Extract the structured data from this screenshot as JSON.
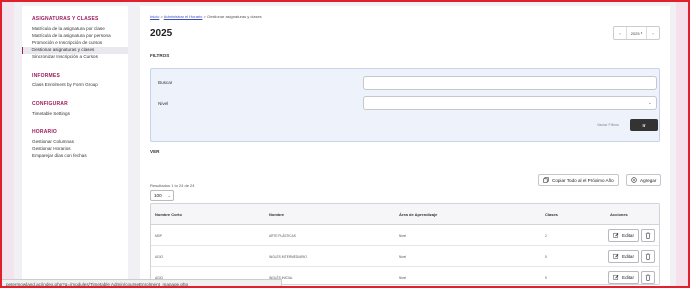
{
  "sidebar": {
    "sections": [
      {
        "title": "ASIGNATURAS Y CLASES",
        "items": [
          "Matrícula de la asignatura por clase",
          "Matrícula de la asignatura por persona",
          "Promoción e Inscripción de cursos",
          "Gestionar asignaturas y clases",
          "Sincronizar Inscripción a Cursos"
        ],
        "active_index": 3
      },
      {
        "title": "INFORMES",
        "items": [
          "Class Enrolment by Form Group"
        ]
      },
      {
        "title": "CONFIGURAR",
        "items": [
          "Timetable Settings"
        ]
      },
      {
        "title": "HORARIO",
        "items": [
          "Gestionar Columnas",
          "Gestionar Horarios",
          "Emparejar días con fechas"
        ]
      }
    ]
  },
  "breadcrumb": {
    "home": "Inicio",
    "sep": ">",
    "module": "Administrar el Horario",
    "current": "Gestionar asignaturas y clases"
  },
  "page_title": "2025",
  "year_selector": {
    "prev": "‹",
    "value": "2025",
    "next": "›",
    "chevron": "▾"
  },
  "filters": {
    "title": "FILTROS",
    "search_label": "Buscar",
    "search_value": "",
    "level_label": "Nivel",
    "level_value": "",
    "clear_label": "Vaciar Filtros",
    "go_label": "Ir"
  },
  "view": {
    "title": "VER",
    "results_text": "Resultados 1 to 24 de 24",
    "page_size": "100",
    "copy_button": "Copiar Todo al el Próximo Año",
    "add_button": "Agregar"
  },
  "table": {
    "columns": [
      "Nombre Corto",
      "Nombre",
      "Área de Aprendizaje",
      "Clases",
      "Acciones"
    ],
    "rows": [
      {
        "short": "MDP",
        "name": "ARTE PLÁSTICAS",
        "area": "Nivel",
        "classes": "2"
      },
      {
        "short": "AGIO",
        "name": "INGLÉS INTERMEDIARIO",
        "area": "Nivel",
        "classes": "5"
      },
      {
        "short": "AGIO",
        "name": "INGLÉS INICIAL",
        "area": "Nivel",
        "classes": "5"
      }
    ],
    "edit_label": "Editar"
  },
  "status_url": "petermowland.ac/index.php?q=/modules/Timetable Admin/courseEnrolment_manage.php",
  "colors": {
    "accent": "#9b1c5a",
    "frame": "#e0202a",
    "primary_button": "#333333"
  },
  "icons": {
    "copy": "copy-icon",
    "add": "plus-circle-icon",
    "edit": "pencil-icon",
    "delete": "trash-icon"
  }
}
